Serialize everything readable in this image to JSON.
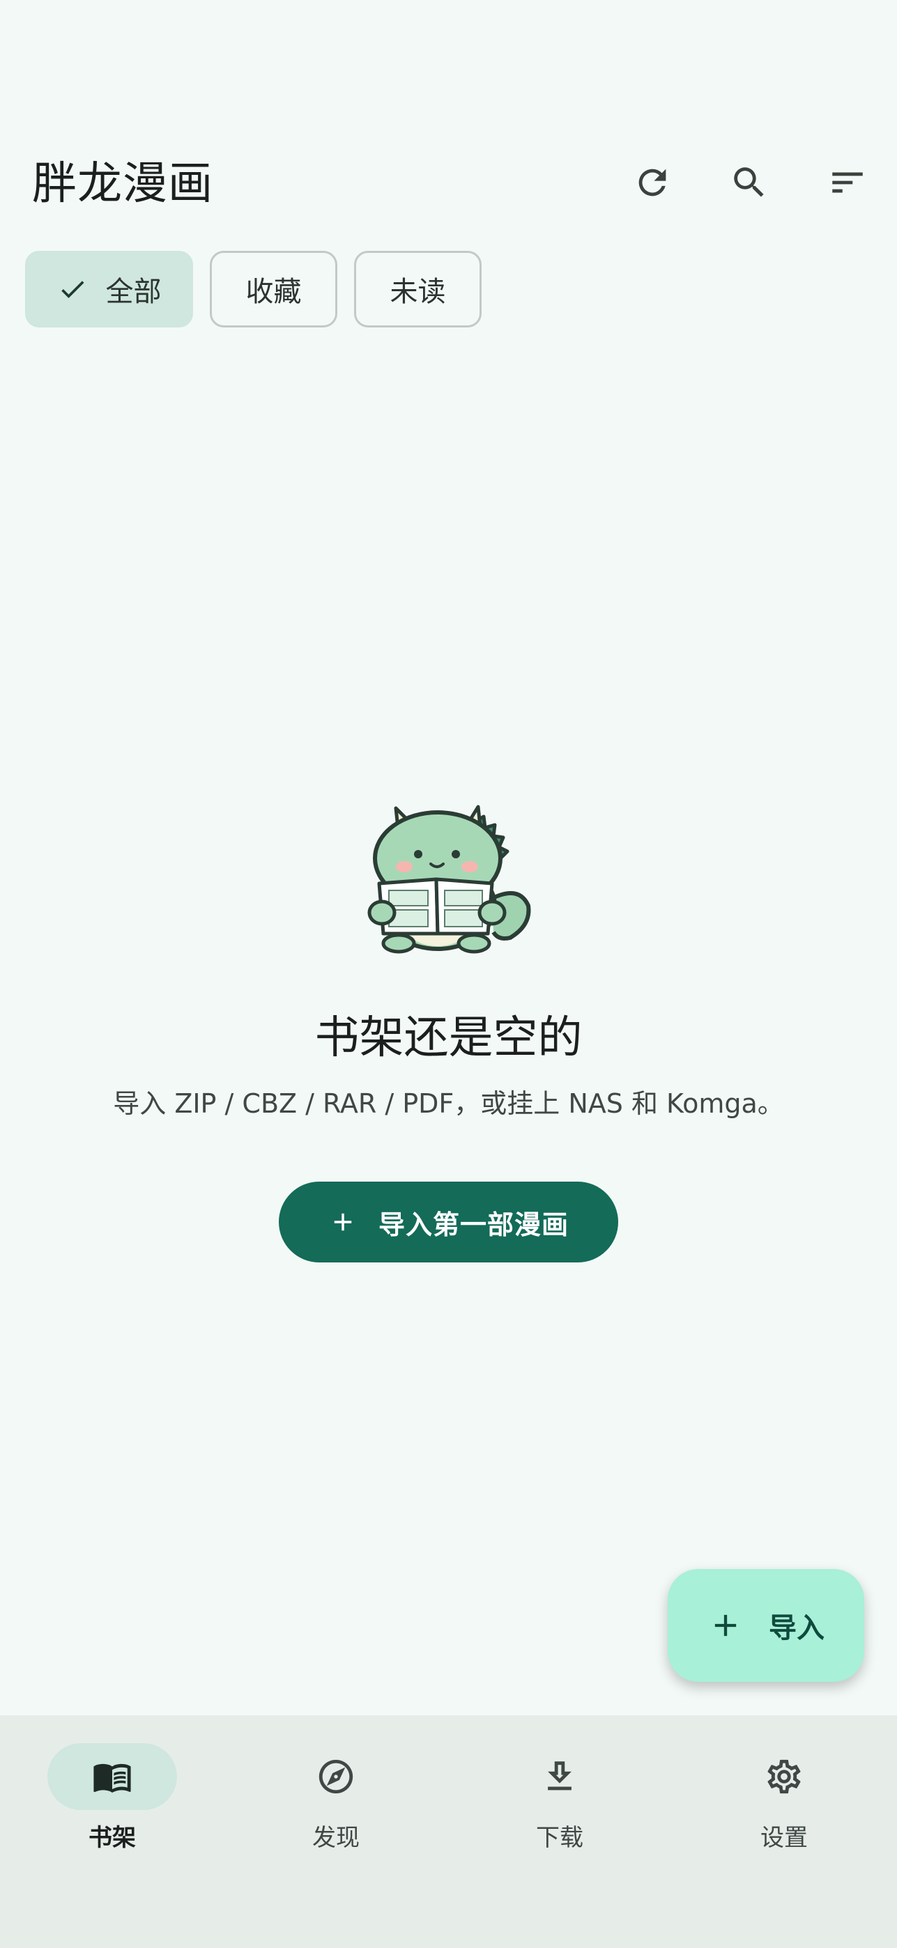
{
  "app": {
    "title": "胖龙漫画"
  },
  "toolbar": {
    "refresh_icon": "refresh-icon",
    "search_icon": "search-icon",
    "sort_icon": "sort-icon"
  },
  "filters": [
    {
      "label": "全部",
      "selected": true
    },
    {
      "label": "收藏",
      "selected": false
    },
    {
      "label": "未读",
      "selected": false
    }
  ],
  "empty_state": {
    "illustration": "dragon-reading-mascot",
    "title": "书架还是空的",
    "subtitle": "导入 ZIP / CBZ / RAR / PDF，或挂上 NAS 和 Komga。",
    "button_label": "导入第一部漫画"
  },
  "fab": {
    "label": "导入"
  },
  "bottom_nav": [
    {
      "label": "书架",
      "icon": "book-icon",
      "active": true
    },
    {
      "label": "发现",
      "icon": "compass-icon",
      "active": false
    },
    {
      "label": "下载",
      "icon": "download-icon",
      "active": false
    },
    {
      "label": "设置",
      "icon": "gear-icon",
      "active": false
    }
  ],
  "colors": {
    "background": "#f3f9f6",
    "primary": "#136b58",
    "chip_selected": "#cfe7de",
    "fab": "#a8f0d8",
    "nav_bar": "#e6ede9"
  }
}
